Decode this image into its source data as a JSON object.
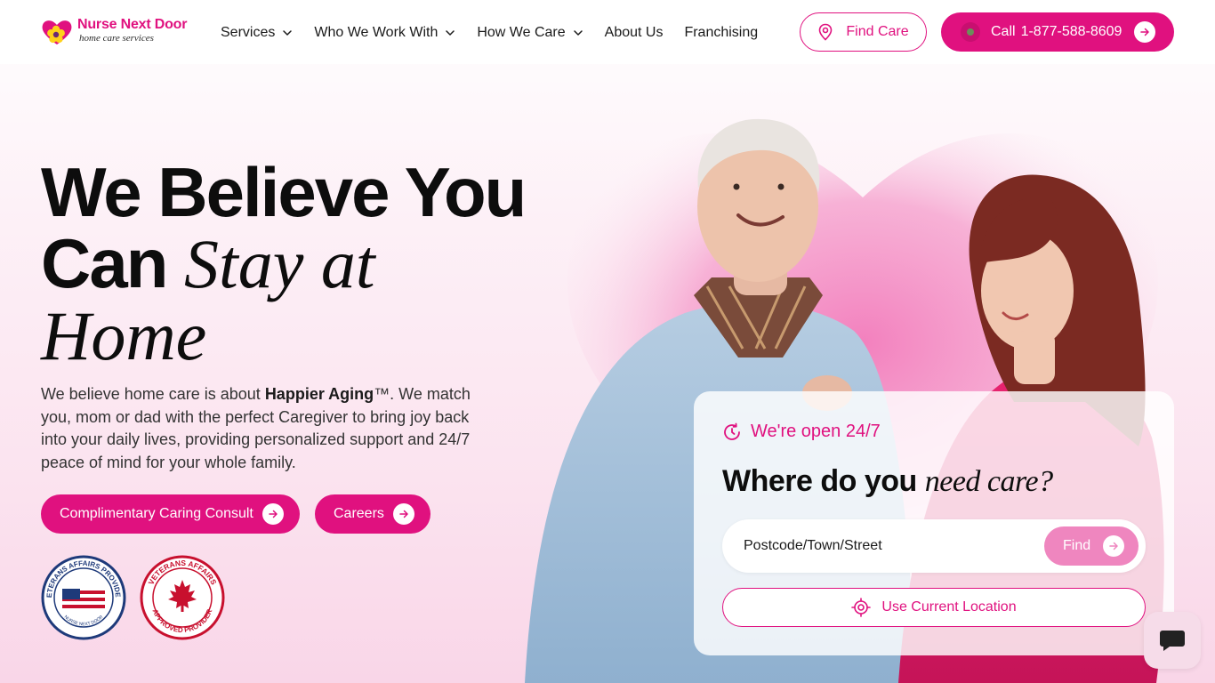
{
  "brand": {
    "name": "Nurse Next Door",
    "tagline": "home care services",
    "accent_color": "#e0117f",
    "accent_light": "#ef86bf"
  },
  "nav": {
    "items": [
      {
        "label": "Services",
        "has_dropdown": true
      },
      {
        "label": "Who We Work With",
        "has_dropdown": true
      },
      {
        "label": "How We Care",
        "has_dropdown": true
      },
      {
        "label": "About Us",
        "has_dropdown": false
      },
      {
        "label": "Franchising",
        "has_dropdown": false
      }
    ],
    "find_care_label": "Find Care",
    "call_label": "Call",
    "call_number": "1-877-588-8609"
  },
  "hero": {
    "headline_line1": "We Believe You",
    "headline_can": "Can",
    "headline_italic1": "Stay at",
    "headline_italic2": "Home",
    "lead_before": "We believe home care is about ",
    "lead_bold": "Happier Aging",
    "lead_tm": "™",
    "lead_after": ". We match you, mom or dad with the perfect Caregiver to bring joy back into your daily lives, providing personalized support and 24/7 peace of mind for your whole family.",
    "consult_button": "Complimentary Caring Consult",
    "careers_button": "Careers"
  },
  "badges": {
    "us_text_top": "VETERANS AFFAIRS PROVIDER",
    "us_text_bottom": "NURSE NEXT DOOR",
    "ca_text_top": "VETERANS AFFAIRS",
    "ca_text_bottom": "APPROVED PROVIDER"
  },
  "search_card": {
    "open_label": "We're open 24/7",
    "title_plain": "Where do you ",
    "title_italic": "need care?",
    "input_placeholder": "Postcode/Town/Street",
    "find_button": "Find",
    "location_button": "Use Current Location"
  },
  "chat": {
    "icon": "chat-bubble-icon"
  }
}
